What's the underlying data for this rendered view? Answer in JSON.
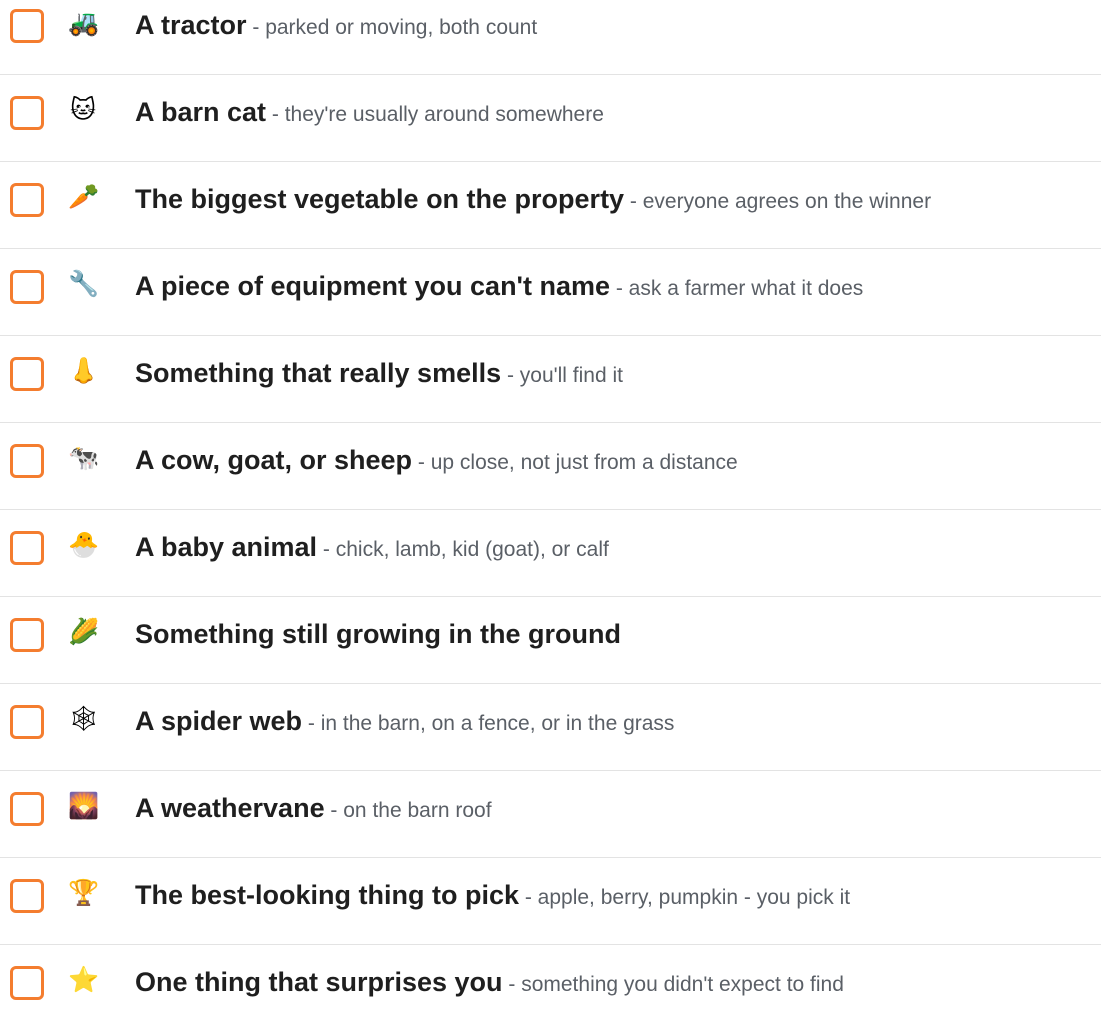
{
  "items": [
    {
      "icon": "tractor-icon",
      "glyph": "🚜",
      "title": "A tractor",
      "desc": " - parked or moving, both count"
    },
    {
      "icon": "cat-icon",
      "glyph": "🐱",
      "title": "A barn cat",
      "desc": " - they're usually around somewhere"
    },
    {
      "icon": "carrot-icon",
      "glyph": "🥕",
      "title": "The biggest vegetable on the property",
      "desc": " - everyone agrees on the winner"
    },
    {
      "icon": "wrench-icon",
      "glyph": "🔧",
      "title": "A piece of equipment you can't name",
      "desc": " - ask a farmer what it does"
    },
    {
      "icon": "nose-icon",
      "glyph": "👃",
      "title": "Something that really smells",
      "desc": " - you'll find it"
    },
    {
      "icon": "cow-icon",
      "glyph": "🐄",
      "title": "A cow, goat, or sheep",
      "desc": " - up close, not just from a distance"
    },
    {
      "icon": "hatching-chick-icon",
      "glyph": "🐣",
      "title": "A baby animal",
      "desc": " - chick, lamb, kid (goat), or calf"
    },
    {
      "icon": "corn-icon",
      "glyph": "🌽",
      "title": "Something still growing in the ground",
      "desc": ""
    },
    {
      "icon": "spider-web-icon",
      "glyph": "🕸",
      "title": "A spider web",
      "desc": " - in the barn, on a fence, or in the grass"
    },
    {
      "icon": "sunrise-icon",
      "glyph": "🌄",
      "title": "A weathervane",
      "desc": " - on the barn roof"
    },
    {
      "icon": "trophy-icon",
      "glyph": "🏆",
      "title": "The best-looking thing to pick",
      "desc": " - apple, berry, pumpkin - you pick it"
    },
    {
      "icon": "star-icon",
      "glyph": "⭐",
      "title": "One thing that surprises you",
      "desc": " - something you didn't expect to find"
    }
  ],
  "colors": {
    "checkbox_border": "#f47d2f",
    "title_text": "#1f1f1f",
    "desc_text": "#5a5f66",
    "divider": "#e3e3e3"
  }
}
